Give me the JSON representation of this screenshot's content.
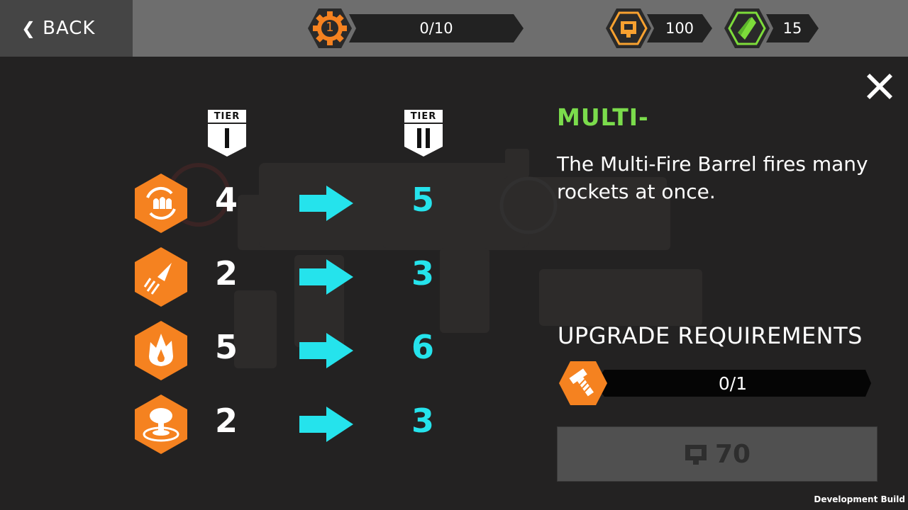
{
  "header": {
    "back_label": "BACK",
    "level": {
      "icon": "gear-level-icon",
      "value": "1",
      "progress_text": "0/10",
      "color": "#f58220"
    },
    "currency_gold": {
      "icon": "chip-currency-icon",
      "value": "100",
      "color": "#f8a130"
    },
    "currency_gem": {
      "icon": "green-crystal-icon",
      "value": "15",
      "color": "#7ddc3a"
    }
  },
  "tiers": {
    "from": {
      "label": "TIER",
      "numeral": "I"
    },
    "to": {
      "label": "TIER",
      "numeral": "II"
    }
  },
  "stats": [
    {
      "icon": "multi-rocket-icon",
      "from": "4",
      "to": "5"
    },
    {
      "icon": "rocket-speed-icon",
      "from": "2",
      "to": "3"
    },
    {
      "icon": "fire-damage-icon",
      "from": "5",
      "to": "6"
    },
    {
      "icon": "explosion-radius-icon",
      "from": "2",
      "to": "3"
    }
  ],
  "item": {
    "title": "MULTI-",
    "description": "The Multi-Fire Barrel fires many rockets at once."
  },
  "requirements": {
    "title": "UPGRADE REQUIREMENTS",
    "icon": "bolt-part-icon",
    "progress": "0/1"
  },
  "purchase": {
    "icon": "chip-currency-icon",
    "price": "70"
  },
  "footer": {
    "build_label": "Development Build"
  },
  "colors": {
    "accent_orange": "#f58220",
    "new_value_cyan": "#25e3ec",
    "title_green": "#7bdc4c"
  }
}
